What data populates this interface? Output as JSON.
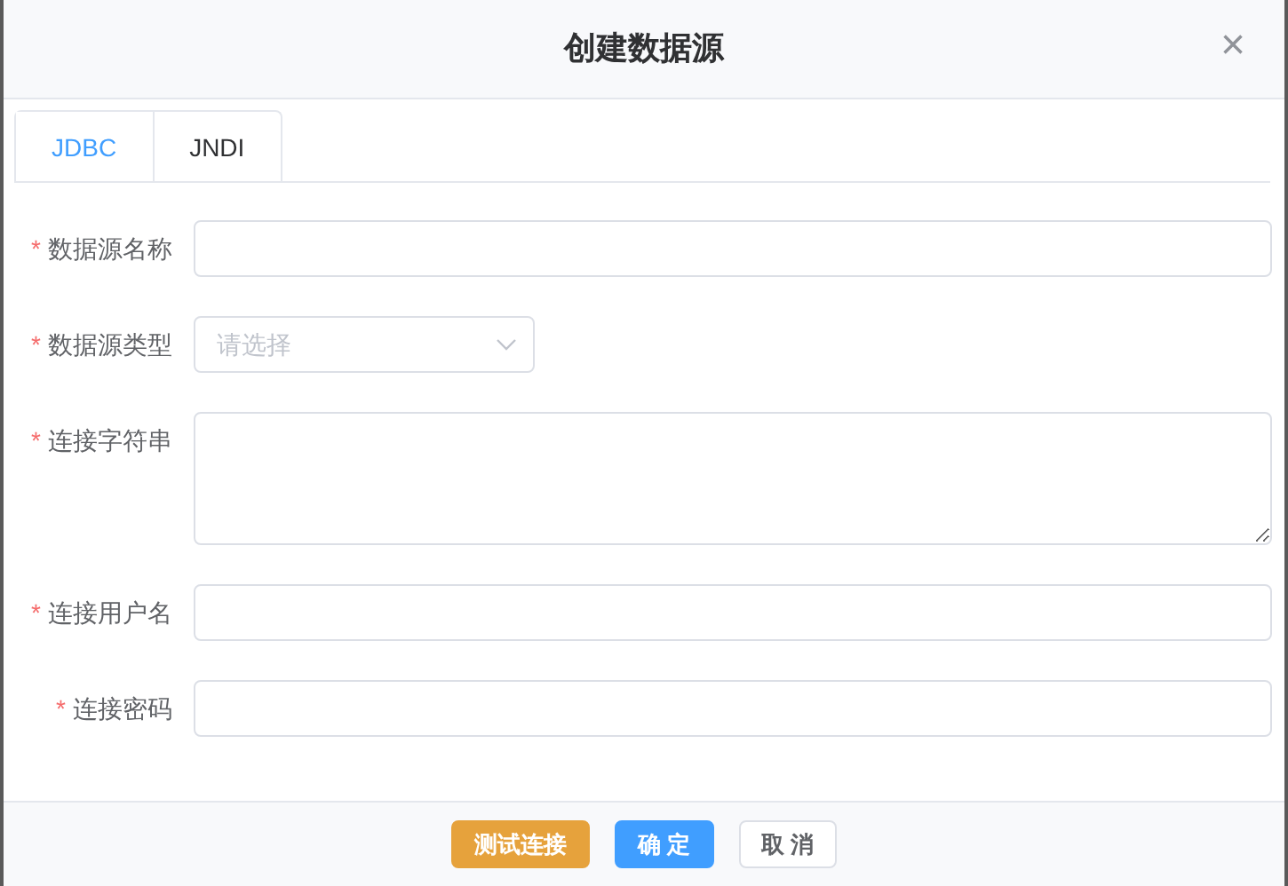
{
  "dialog": {
    "title": "创建数据源",
    "close": "×"
  },
  "tabs": [
    {
      "label": "JDBC",
      "selected": true
    },
    {
      "label": "JNDI",
      "selected": false
    }
  ],
  "fields": [
    {
      "kind": "input",
      "label": "数据源名称",
      "required_mark": "*"
    },
    {
      "kind": "select",
      "label": "数据源类型",
      "required_mark": "*",
      "placeholder": "请选择"
    },
    {
      "kind": "textarea",
      "label": "连接字符串",
      "required_mark": "*"
    },
    {
      "kind": "input",
      "label": "连接用户名",
      "required_mark": "*"
    },
    {
      "kind": "password",
      "label": "连接密码",
      "required_mark": "*"
    }
  ],
  "buttons": [
    {
      "kind": "warning",
      "label": "测试连接"
    },
    {
      "kind": "primary",
      "label": "确 定"
    },
    {
      "kind": "default",
      "label": "取 消"
    }
  ]
}
